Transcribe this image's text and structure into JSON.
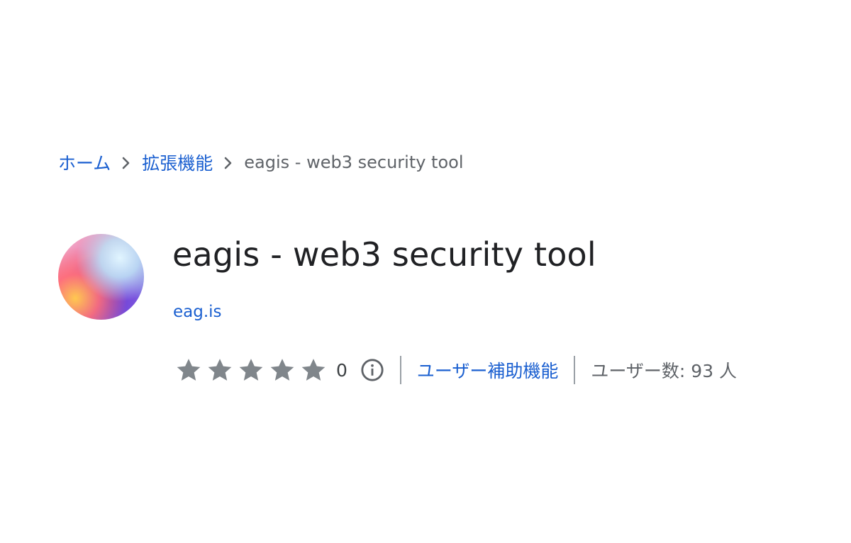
{
  "breadcrumb": {
    "home": "ホーム",
    "extensions": "拡張機能",
    "current": "eagis - web3 security tool"
  },
  "extension": {
    "title": "eagis - web3 security tool",
    "domain": "eag.is",
    "rating": {
      "stars_filled": 0,
      "stars_total": 5,
      "count": "0"
    },
    "accessibility_label": "ユーザー補助機能",
    "users_label": "ユーザー数: 93 人"
  },
  "colors": {
    "link": "#1a5fd0",
    "text_primary": "#202124",
    "text_secondary": "#5f6368",
    "star_empty": "#80868b"
  },
  "icons": {
    "separator": "chevron-right-icon",
    "star": "star-icon",
    "info": "info-icon"
  }
}
